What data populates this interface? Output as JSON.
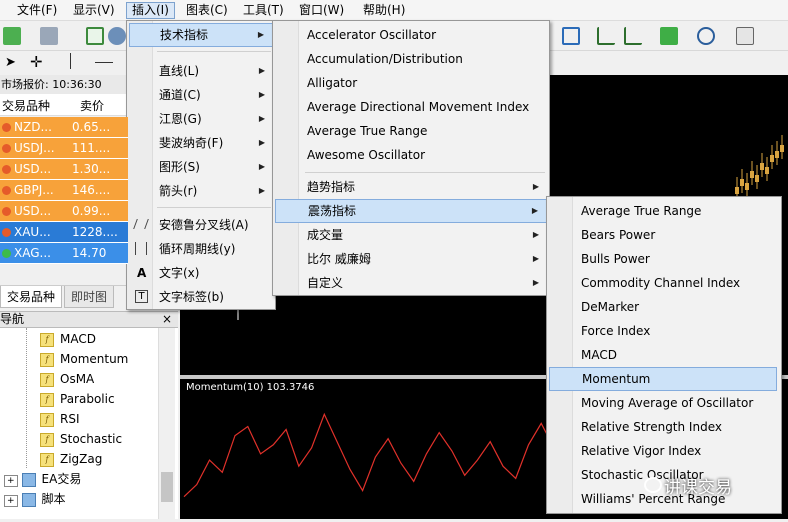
{
  "menubar": {
    "items": [
      "文件(F)",
      "显示(V)",
      "插入(I)",
      "图表(C)",
      "工具(T)",
      "窗口(W)",
      "帮助(H)"
    ]
  },
  "market_watch": {
    "title": "市场报价: 10:36:30",
    "col_symbol": "交易品种",
    "col_bid": "卖价",
    "rows": [
      {
        "symbol": "NZD...",
        "bid": "0.65...",
        "color": "#f7a23a",
        "dot": "#e55b2a"
      },
      {
        "symbol": "USDJ...",
        "bid": "111....",
        "color": "#f7a23a",
        "dot": "#e55b2a"
      },
      {
        "symbol": "USD...",
        "bid": "1.30...",
        "color": "#f7a23a",
        "dot": "#e55b2a"
      },
      {
        "symbol": "GBPJ...",
        "bid": "146....",
        "color": "#f7a23a",
        "dot": "#e55b2a"
      },
      {
        "symbol": "USD...",
        "bid": "0.99...",
        "color": "#f7a23a",
        "dot": "#e55b2a"
      },
      {
        "symbol": "XAU...",
        "bid": "1228....",
        "color": "#2a7bd6",
        "dot": "#e55b2a"
      },
      {
        "symbol": "XAG...",
        "bid": "14.70",
        "color": "#3b8fe8",
        "dot": "#3dbb4a"
      }
    ],
    "tabs": [
      "交易品种",
      "即时图"
    ]
  },
  "navigator": {
    "title": "导航",
    "indicators": [
      "MACD",
      "Momentum",
      "OsMA",
      "Parabolic",
      "RSI",
      "Stochastic",
      "ZigZag"
    ],
    "folders": [
      "EA交易",
      "脚本"
    ]
  },
  "insert_menu": {
    "items": [
      "技术指标",
      "直线(L)",
      "通道(C)",
      "江恩(G)",
      "斐波纳奇(F)",
      "图形(S)",
      "箭头(r)",
      "安德鲁分叉线(A)",
      "循环周期线(y)",
      "文字(x)",
      "文字标签(b)"
    ],
    "icon_text": "A",
    "icon_label": "T"
  },
  "indicators_menu": {
    "items": [
      "Accelerator Oscillator",
      "Accumulation/Distribution",
      "Alligator",
      "Average Directional Movement Index",
      "Average True Range",
      "Awesome Oscillator"
    ],
    "groups": [
      "趋势指标",
      "震荡指标",
      "成交量",
      "比尔 威廉姆",
      "自定义"
    ]
  },
  "oscillators_menu": {
    "items": [
      "Average True Range",
      "Bears Power",
      "Bulls Power",
      "Commodity Channel Index",
      "DeMarker",
      "Force Index",
      "MACD",
      "Momentum",
      "Moving Average of Oscillator",
      "Relative Strength Index",
      "Relative Vigor Index",
      "Stochastic Oscillator",
      "Williams' Percent Range"
    ]
  },
  "indicator_window": {
    "label": "Momentum(10) 103.3746",
    "line_color": "#e0312a",
    "values": [
      99.2,
      99.6,
      100.4,
      100.0,
      101.2,
      101.5,
      100.6,
      100.9,
      101.4,
      100.2,
      100.8,
      101.9,
      101.0,
      100.1,
      99.4,
      100.5,
      101.1,
      100.3,
      99.7,
      100.6,
      101.3,
      100.7,
      99.9,
      100.4,
      101.0,
      100.2,
      99.8,
      100.9,
      101.6,
      100.8
    ]
  },
  "watermark": "讲课交易",
  "colors": {
    "highlight": "#cce2f8",
    "chart_bg": "#000000",
    "candle": "#d9a441"
  }
}
